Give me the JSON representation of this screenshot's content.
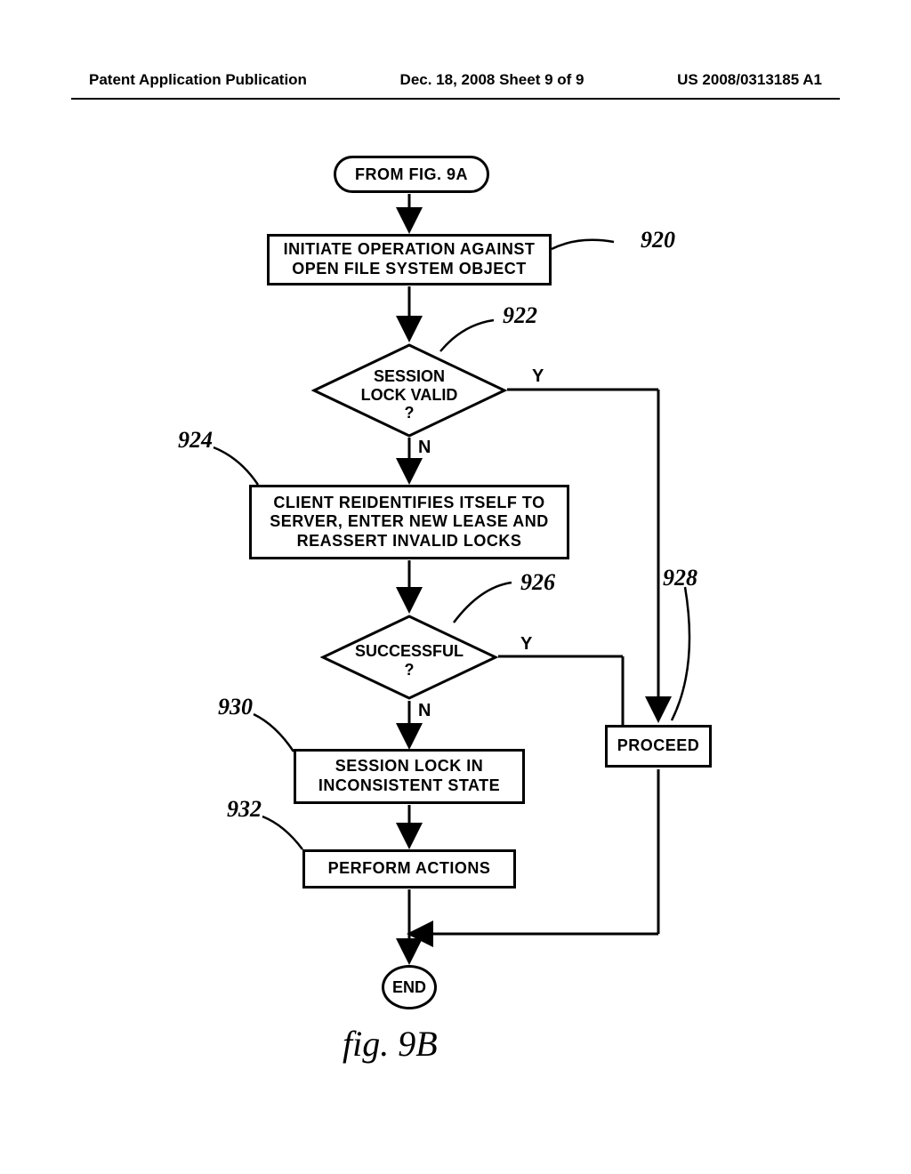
{
  "header": {
    "left": "Patent Application Publication",
    "center": "Dec. 18, 2008  Sheet 9 of 9",
    "right": "US 2008/0313185 A1"
  },
  "flow": {
    "start": "FROM FIG. 9A",
    "step920": "INITIATE OPERATION AGAINST OPEN FILE SYSTEM OBJECT",
    "ref920": "920",
    "dec922": "SESSION LOCK VALID ?",
    "ref922": "922",
    "y922": "Y",
    "n922": "N",
    "step924": "CLIENT REIDENTIFIES ITSELF TO SERVER, ENTER NEW LEASE AND REASSERT INVALID LOCKS",
    "ref924": "924",
    "dec926": "SUCCESSFUL ?",
    "ref926": "926",
    "y926": "Y",
    "n926": "N",
    "step928": "PROCEED",
    "ref928": "928",
    "step930": "SESSION LOCK IN INCONSISTENT STATE",
    "ref930": "930",
    "step932": "PERFORM ACTIONS",
    "ref932": "932",
    "end": "END"
  },
  "caption": "fig.  9B"
}
